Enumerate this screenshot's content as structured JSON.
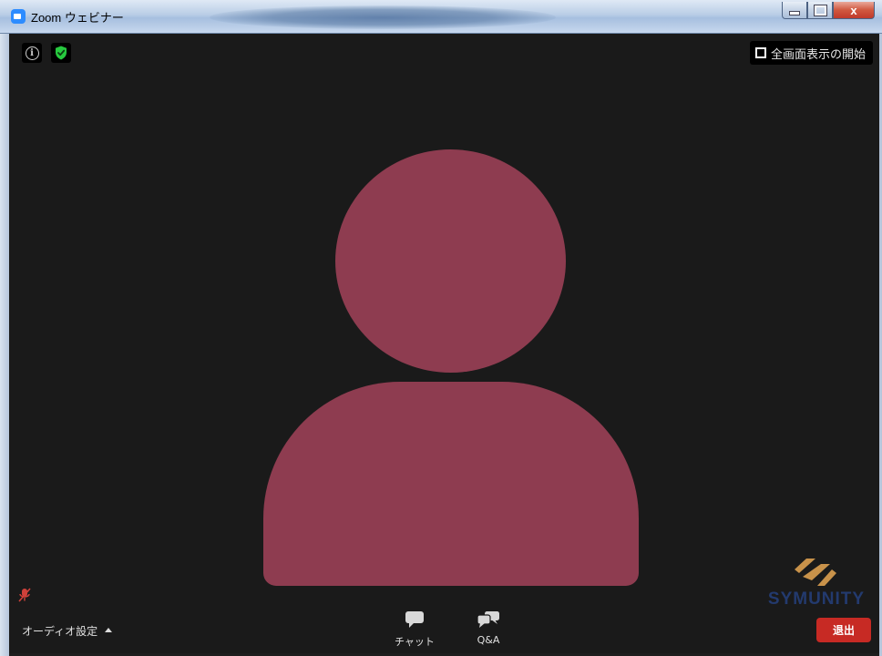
{
  "window": {
    "title": "Zoom ウェビナー",
    "controls": {
      "minimize": "minimize",
      "maximize": "maximize",
      "close": "x"
    }
  },
  "top_bar": {
    "info_icon": "info-icon",
    "encryption_icon": "shield-check-icon",
    "fullscreen_label": "全画面表示の開始"
  },
  "video": {
    "avatar_color": "#8e3c50",
    "background": "#1a1a1a"
  },
  "watermark": {
    "brand_text": "SYMUNITY"
  },
  "bottom_bar": {
    "audio_settings_label": "オーディオ設定",
    "chat_label": "チャット",
    "qa_label": "Q&A",
    "leave_label": "退出"
  },
  "colors": {
    "accent_shield": "#27c93f",
    "leave_button": "#c72a24",
    "avatar": "#8e3c50",
    "logo_mark": "#c8924a",
    "logo_text": "#233a6e"
  }
}
